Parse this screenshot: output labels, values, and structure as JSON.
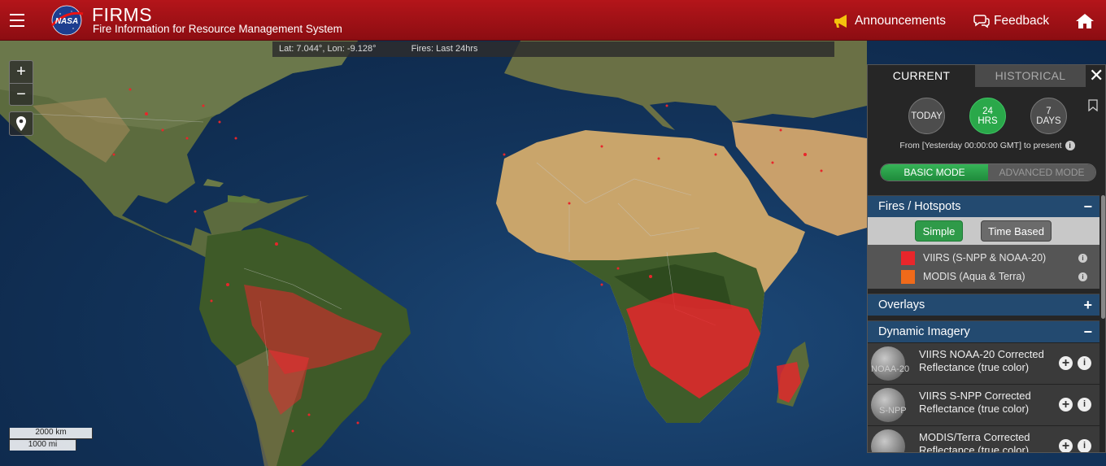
{
  "header": {
    "logo_text": "NASA",
    "title": "FIRMS",
    "subtitle": "Fire Information for Resource Management System",
    "announcements": "Announcements",
    "feedback": "Feedback"
  },
  "map": {
    "coordinates": "Lat: 7.044°, Lon: -9.128°",
    "fires_label": "Fires: Last 24hrs",
    "zoom_in": "+",
    "zoom_out": "−",
    "scale_km": "2000 km",
    "scale_mi": "1000 mi"
  },
  "panel": {
    "tabs": {
      "current": "CURRENT",
      "historical": "HISTORICAL"
    },
    "close": "✕",
    "range": {
      "today": "TODAY",
      "hrs_num": "24",
      "hrs_unit": "HRS",
      "days_num": "7",
      "days_unit": "DAYS",
      "selected": "24 HRS"
    },
    "range_note": "From [Yesterday 00:00:00 GMT] to present",
    "modes": {
      "basic": "BASIC MODE",
      "advanced": "ADVANCED MODE",
      "selected": "BASIC MODE"
    },
    "fires_section": {
      "title": "Fires / Hotspots",
      "toggle": "−",
      "simple": "Simple",
      "time_based": "Time Based",
      "legend": [
        {
          "label": "VIIRS (S-NPP & NOAA-20)",
          "color": "#e8262b"
        },
        {
          "label": "MODIS (Aqua & Terra)",
          "color": "#f06a1a"
        }
      ]
    },
    "overlays_section": {
      "title": "Overlays",
      "toggle": "+"
    },
    "imagery_section": {
      "title": "Dynamic Imagery",
      "toggle": "−",
      "items": [
        {
          "thumb_label": "NOAA-20",
          "name": "VIIRS NOAA-20 Corrected Reflectance (true color)"
        },
        {
          "thumb_label": "S-NPP",
          "name": "VIIRS S-NPP Corrected Reflectance (true color)"
        },
        {
          "thumb_label": "",
          "name": "MODIS/Terra Corrected Reflectance (true color)"
        }
      ]
    }
  },
  "colors": {
    "header_red": "#a51116",
    "active_green": "#2aa84a",
    "section_blue": "#234a70",
    "fire_red": "#e8262b"
  }
}
